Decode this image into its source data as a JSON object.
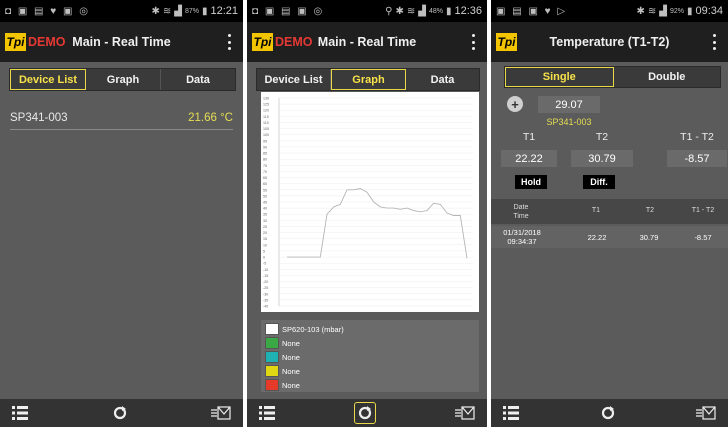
{
  "phone1": {
    "status": {
      "time": "12:21",
      "battery": "87%"
    },
    "appbar": {
      "logo": "Tpi",
      "demo": "DEMO",
      "title": "Main - Real Time"
    },
    "tabs": [
      "Device List",
      "Graph",
      "Data"
    ],
    "active_tab": "Device List",
    "device": {
      "name": "SP341-003",
      "value": "21.66 °C"
    }
  },
  "phone2": {
    "status": {
      "time": "12:36",
      "battery": "48%"
    },
    "appbar": {
      "logo": "Tpi",
      "demo": "DEMO",
      "title": "Main - Real Time"
    },
    "tabs": [
      "Device List",
      "Graph",
      "Data"
    ],
    "active_tab": "Graph",
    "legend": [
      {
        "label": "SP620-103 (mbar)",
        "color": "#ffffff"
      },
      {
        "label": "None",
        "color": "#3aa845"
      },
      {
        "label": "None",
        "color": "#20b2b2"
      },
      {
        "label": "None",
        "color": "#e0d812"
      },
      {
        "label": "None",
        "color": "#e53a2a"
      }
    ],
    "chart_data": {
      "type": "line",
      "y_ticks": [
        "130",
        "125",
        "120",
        "115",
        "110",
        "105",
        "100",
        "95",
        "90",
        "85",
        "80",
        "75",
        "70",
        "65",
        "60",
        "55",
        "50",
        "45",
        "40",
        "35",
        "30",
        "25",
        "20",
        "15",
        "10",
        "5",
        "0",
        "-5",
        "-10",
        "-15",
        "-20",
        "-25",
        "-30",
        "-35",
        "-40"
      ],
      "ylim": [
        -40,
        130
      ],
      "series": [
        {
          "values": [
            0,
            0,
            0,
            0,
            0,
            0,
            35,
            41,
            43,
            55,
            55,
            56,
            53,
            45,
            41,
            40,
            40,
            39,
            40,
            38,
            37,
            38,
            44,
            43,
            36,
            34,
            34,
            -1
          ]
        }
      ]
    }
  },
  "phone3": {
    "status": {
      "time": "09:34",
      "battery": "92%"
    },
    "appbar": {
      "logo": "Tpi",
      "title": "Temperature (T1-T2)"
    },
    "segments": [
      "Single",
      "Double"
    ],
    "active_segment": "Single",
    "value": "29.07",
    "device": "SP341-003",
    "labels": {
      "t1": "T1",
      "t2": "T2",
      "diff": "T1 - T2"
    },
    "values": {
      "t1": "22.22",
      "t2": "30.79",
      "diff": "-8.57"
    },
    "buttons": {
      "hold": "Hold",
      "diff": "Diff."
    },
    "table": {
      "headers": [
        "Date\nTime",
        "T1",
        "T2",
        "T1 - T2"
      ],
      "row": {
        "date": "01/31/2018",
        "time": "09:34:37",
        "t1": "22.22",
        "t2": "30.79",
        "diff": "-8.57"
      }
    }
  },
  "colors": {
    "accent_yellow": "#f7e24a",
    "demo_red": "#e53935",
    "logo_yellow": "#f2c500"
  },
  "icons": {
    "list": "list-icon",
    "refresh": "refresh-icon",
    "export": "email-export-icon"
  }
}
